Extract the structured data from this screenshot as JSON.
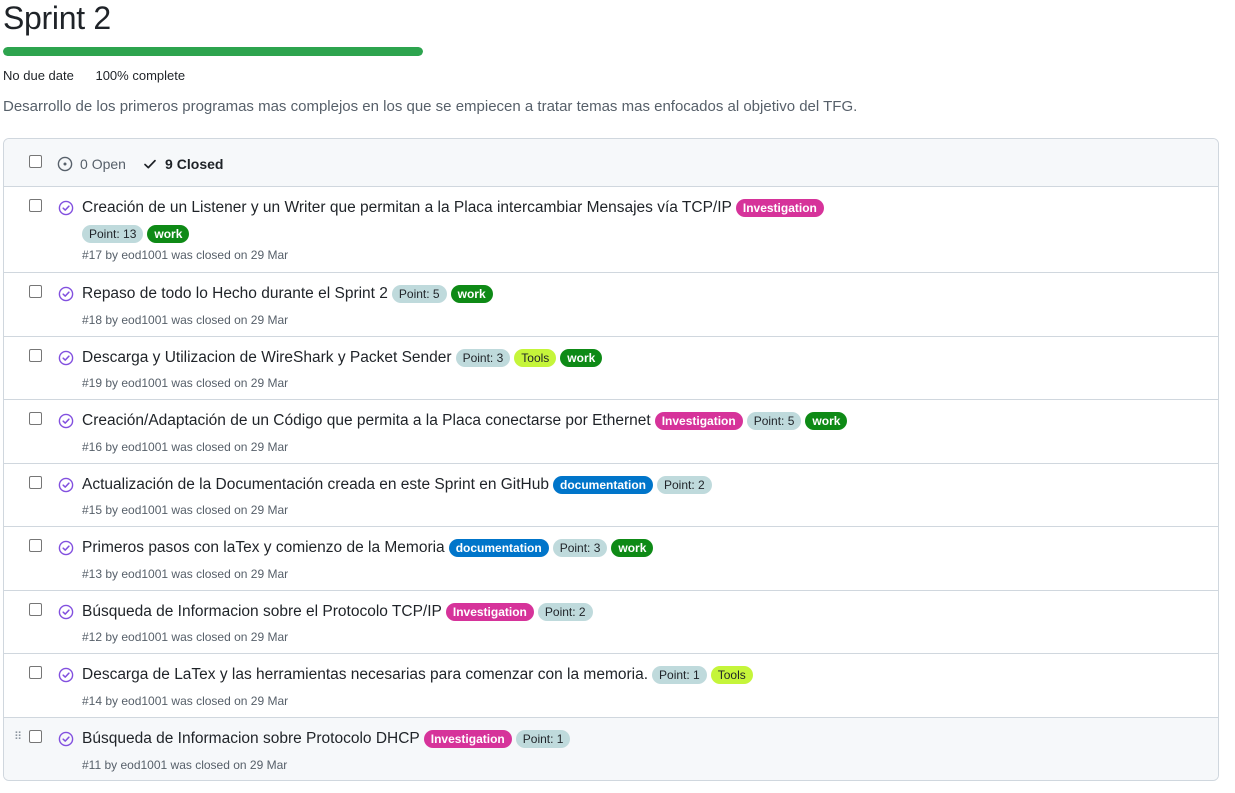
{
  "milestone": {
    "title": "Sprint 2",
    "progress_fraction": 1.0,
    "due": "No due date",
    "percent": "100%",
    "complete_label": "complete",
    "description": "Desarrollo de los primeros programas mas complejos en los que se empiecen a tratar temas mas enfocados al objetivo del TFG."
  },
  "colors": {
    "progress": "#2da44e",
    "closed_icon": "#8250df",
    "investigation": "#d6339a",
    "point": "#bfdadc",
    "work": "#0e8a16",
    "tools": "#c5f53a",
    "documentation": "#0075ca"
  },
  "header": {
    "open_count": "0",
    "open_label": "Open",
    "closed_count": "9",
    "closed_label": "Closed"
  },
  "issues": [
    {
      "title": "Creación de un Listener y un Writer que permitan a la Placa intercambiar Mensajes vía TCP/IP",
      "labels": [
        {
          "text": "Investigation",
          "bg": "#d6339a",
          "fg": "#ffffff",
          "bold": true
        },
        {
          "text": "Point: 13",
          "bg": "#bfdadc",
          "fg": "#1f2328",
          "bold": false
        },
        {
          "text": "work",
          "bg": "#0e8a16",
          "fg": "#ffffff",
          "bold": true
        }
      ],
      "meta": "#17 by eod1001 was closed on 29 Mar"
    },
    {
      "title": "Repaso de todo lo Hecho durante el Sprint 2",
      "labels": [
        {
          "text": "Point: 5",
          "bg": "#bfdadc",
          "fg": "#1f2328",
          "bold": false
        },
        {
          "text": "work",
          "bg": "#0e8a16",
          "fg": "#ffffff",
          "bold": true
        }
      ],
      "meta": "#18 by eod1001 was closed on 29 Mar"
    },
    {
      "title": "Descarga y Utilizacion de WireShark y Packet Sender",
      "labels": [
        {
          "text": "Point: 3",
          "bg": "#bfdadc",
          "fg": "#1f2328",
          "bold": false
        },
        {
          "text": "Tools",
          "bg": "#c5f53a",
          "fg": "#1f2328",
          "bold": false
        },
        {
          "text": "work",
          "bg": "#0e8a16",
          "fg": "#ffffff",
          "bold": true
        }
      ],
      "meta": "#19 by eod1001 was closed on 29 Mar"
    },
    {
      "title": "Creación/Adaptación de un Código que permita a la Placa conectarse por Ethernet",
      "labels": [
        {
          "text": "Investigation",
          "bg": "#d6339a",
          "fg": "#ffffff",
          "bold": true
        },
        {
          "text": "Point: 5",
          "bg": "#bfdadc",
          "fg": "#1f2328",
          "bold": false
        },
        {
          "text": "work",
          "bg": "#0e8a16",
          "fg": "#ffffff",
          "bold": true
        }
      ],
      "meta": "#16 by eod1001 was closed on 29 Mar"
    },
    {
      "title": "Actualización de la Documentación creada en este Sprint en GitHub",
      "labels": [
        {
          "text": "documentation",
          "bg": "#0075ca",
          "fg": "#ffffff",
          "bold": true
        },
        {
          "text": "Point: 2",
          "bg": "#bfdadc",
          "fg": "#1f2328",
          "bold": false
        }
      ],
      "meta": "#15 by eod1001 was closed on 29 Mar"
    },
    {
      "title": "Primeros pasos con laTex y comienzo de la Memoria",
      "labels": [
        {
          "text": "documentation",
          "bg": "#0075ca",
          "fg": "#ffffff",
          "bold": true
        },
        {
          "text": "Point: 3",
          "bg": "#bfdadc",
          "fg": "#1f2328",
          "bold": false
        },
        {
          "text": "work",
          "bg": "#0e8a16",
          "fg": "#ffffff",
          "bold": true
        }
      ],
      "meta": "#13 by eod1001 was closed on 29 Mar"
    },
    {
      "title": "Búsqueda de Informacion sobre el Protocolo TCP/IP",
      "labels": [
        {
          "text": "Investigation",
          "bg": "#d6339a",
          "fg": "#ffffff",
          "bold": true
        },
        {
          "text": "Point: 2",
          "bg": "#bfdadc",
          "fg": "#1f2328",
          "bold": false
        }
      ],
      "meta": "#12 by eod1001 was closed on 29 Mar"
    },
    {
      "title": "Descarga de LaTex y las herramientas necesarias para comenzar con la memoria.",
      "labels": [
        {
          "text": "Point: 1",
          "bg": "#bfdadc",
          "fg": "#1f2328",
          "bold": false
        },
        {
          "text": "Tools",
          "bg": "#c5f53a",
          "fg": "#1f2328",
          "bold": false
        }
      ],
      "meta": "#14 by eod1001 was closed on 29 Mar"
    },
    {
      "title": "Búsqueda de Informacion sobre Protocolo DHCP",
      "labels": [
        {
          "text": "Investigation",
          "bg": "#d6339a",
          "fg": "#ffffff",
          "bold": true
        },
        {
          "text": "Point: 1",
          "bg": "#bfdadc",
          "fg": "#1f2328",
          "bold": false
        }
      ],
      "meta": "#11 by eod1001 was closed on 29 Mar"
    }
  ]
}
